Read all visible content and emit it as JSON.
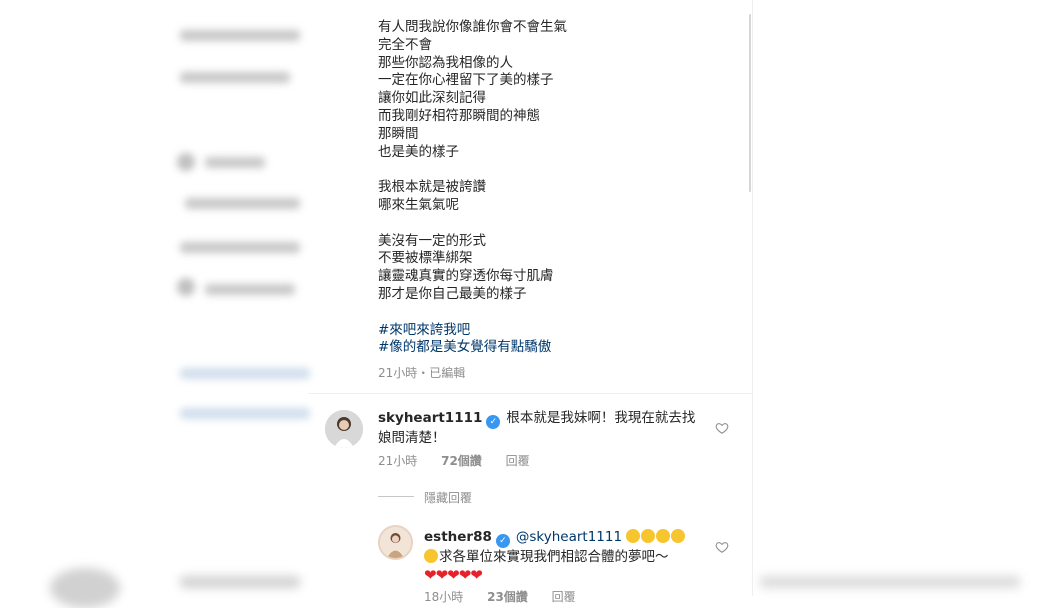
{
  "caption": {
    "lines1": [
      "有人問我說你像誰你會不會生氣",
      "完全不會",
      "那些你認為我相像的人",
      "一定在你心裡留下了美的樣子",
      "讓你如此深刻記得",
      "而我剛好相符那瞬間的神態",
      "那瞬間",
      "也是美的樣子"
    ],
    "lines2": [
      "我根本就是被誇讚",
      "哪來生氣氣呢"
    ],
    "lines3": [
      "美沒有一定的形式",
      "不要被標準綁架",
      "讓靈魂真實的穿透你每寸肌膚",
      "那才是你自己最美的樣子"
    ],
    "hashtags": [
      "#來吧來誇我吧",
      "#像的都是美女覺得有點驕傲"
    ],
    "meta": "21小時・已編輯"
  },
  "comments": [
    {
      "username": "skyheart1111",
      "verified": "✓",
      "text_line1": "根本就是我妹啊！我現在就去找",
      "text_line2": "娘問清楚！",
      "time": "21小時",
      "likes": "72個讚",
      "reply": "回覆"
    }
  ],
  "hide_replies": "隱藏回覆",
  "reply": {
    "username": "esther88",
    "verified": "✓",
    "mention": "@skyheart1111",
    "text": "求各單位來實現我們相認合體的夢吧～",
    "hearts": "❤❤❤❤❤",
    "time": "18小時",
    "likes": "23個讚",
    "reply": "回覆"
  },
  "colors": {
    "link": "#00376b",
    "muted": "#8e8e8e",
    "verified": "#3897f0",
    "heart": "#e8202a"
  }
}
